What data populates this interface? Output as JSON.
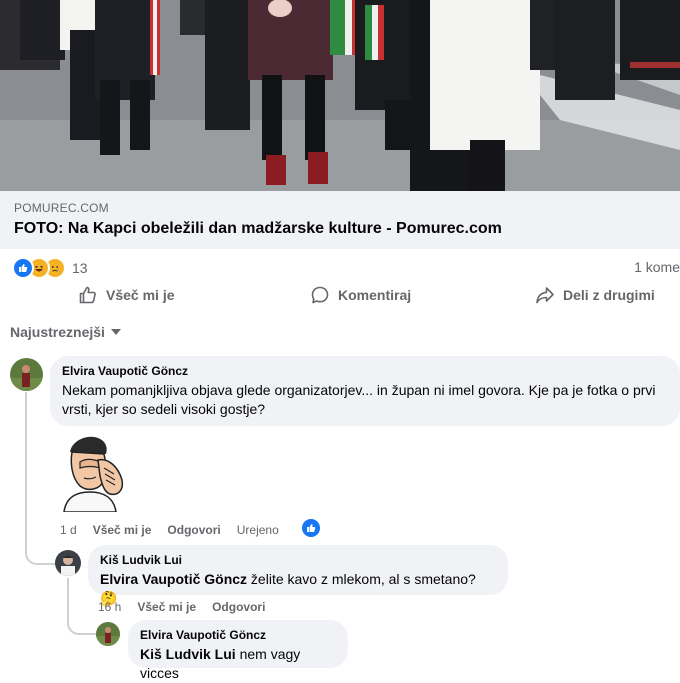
{
  "link_preview": {
    "domain": "POMUREC.COM",
    "title": "FOTO: Na Kapci obeležili dan madžarske kulture - Pomurec.com"
  },
  "reactions": {
    "icons": [
      "like-icon",
      "haha-icon",
      "sad-icon"
    ],
    "count": "13",
    "comments_count": "1 kome"
  },
  "actions": {
    "like": "Všeč mi je",
    "comment": "Komentiraj",
    "share": "Deli z drugimi"
  },
  "sort": {
    "label": "Najustreznejši"
  },
  "comments": [
    {
      "author": "Elvira Vaupotič Göncz",
      "text": "Nekam pomanjkljiva objava glede organizatorjev... in župan ni imel govora. Kje pa je fotka o prvi vrsti, kjer so sedeli visoki gostje?",
      "sticker": "facepalm-sticker",
      "time": "1 d",
      "like": "Všeč mi je",
      "reply": "Odgovori",
      "edited": "Urejeno",
      "replies": [
        {
          "author": "Kiš Ludvik Lui",
          "mention": "Elvira Vaupotič Göncz",
          "text": " želite kavo z mlekom, al s smetano? 🤔",
          "time": "16 h",
          "like": "Všeč mi je",
          "reply": "Odgovori"
        },
        {
          "author": "Elvira Vaupotič Göncz",
          "mention": "Kiš Ludvik Lui",
          "text": " nem vagy vicces"
        }
      ]
    }
  ],
  "colors": {
    "accent": "#1877f2",
    "bubble": "#f0f2f5",
    "secondary_text": "#65676b"
  }
}
